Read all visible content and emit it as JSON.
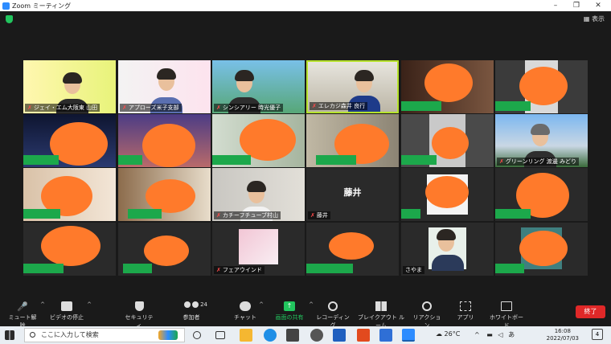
{
  "window": {
    "title": "Zoom ミーティング",
    "min": "–",
    "max": "❐",
    "close": "✕"
  },
  "meetbar": {
    "view_label": "表示"
  },
  "participants": [
    {
      "name": "ジェイ・エム大阪東 山田",
      "muted": true
    },
    {
      "name": "アプローズ米子支部",
      "muted": true
    },
    {
      "name": "シンシアリー 時光優子",
      "muted": true
    },
    {
      "name": "エレカジ森井 良行",
      "muted": true
    },
    {
      "name": "",
      "muted": false
    },
    {
      "name": "",
      "muted": false
    },
    {
      "name": "",
      "muted": false
    },
    {
      "name": "",
      "muted": false
    },
    {
      "name": "",
      "muted": false
    },
    {
      "name": "",
      "muted": false
    },
    {
      "name": "",
      "muted": false
    },
    {
      "name": "グリーンリング 渡邊 みどり",
      "muted": true
    },
    {
      "name": "",
      "muted": false
    },
    {
      "name": "",
      "muted": false
    },
    {
      "name": "カチーフチューブ村山",
      "muted": true
    },
    {
      "name": "藤井",
      "muted": true,
      "big": "藤井"
    },
    {
      "name": "",
      "muted": false
    },
    {
      "name": "",
      "muted": false
    },
    {
      "name": "",
      "muted": false
    },
    {
      "name": "",
      "muted": false
    },
    {
      "name": "フェアウインド",
      "muted": true
    },
    {
      "name": "",
      "muted": false
    },
    {
      "name": "さやま",
      "muted": false
    },
    {
      "name": "",
      "muted": false
    }
  ],
  "toolbar": {
    "mute": "ミュート解除",
    "video": "ビデオの停止",
    "security": "セキュリティ",
    "participants": "参加者",
    "participants_count": "24",
    "chat": "チャット",
    "share": "画面の共有",
    "record": "レコーディング",
    "breakout": "ブレイクアウト ルーム",
    "reactions": "リアクション",
    "apps": "アプリ",
    "whiteboard": "ホワイトボード",
    "end": "終了"
  },
  "taskbar": {
    "search_placeholder": "ここに入力して検索",
    "weather": "26°C",
    "ime": "あ",
    "time": "16:08",
    "date": "2022/07/03",
    "notifications": "4"
  },
  "colors": {
    "accent": "#1ca84b",
    "end": "#e02828",
    "blob": "#ff7a2b",
    "share": "#22c55e"
  }
}
